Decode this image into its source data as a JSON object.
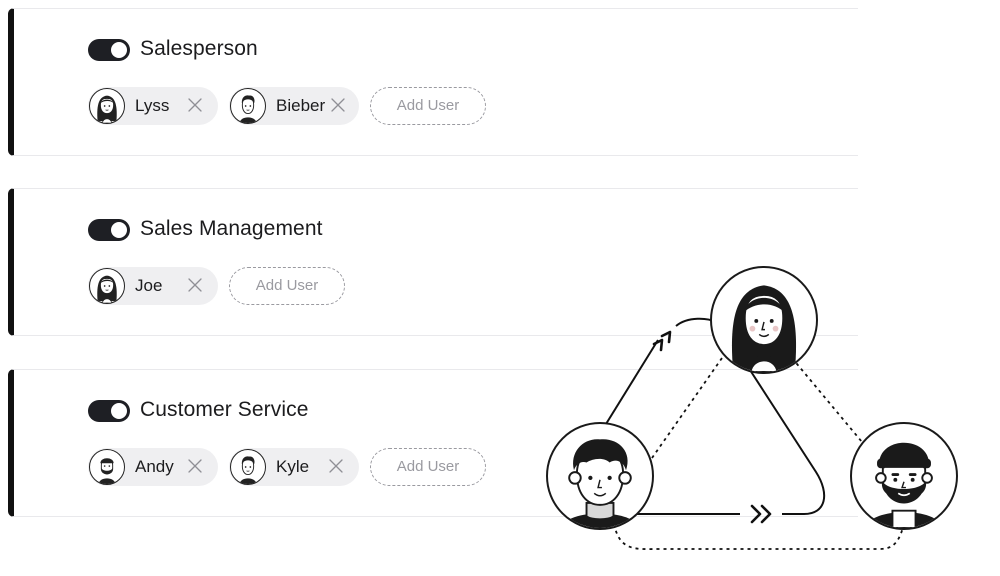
{
  "groups": [
    {
      "title": "Salesperson",
      "enabled": true,
      "users": [
        {
          "name": "Lyss",
          "avatar": "woman-long-hair-avatar"
        },
        {
          "name": "Bieber",
          "avatar": "man-avatar"
        }
      ],
      "add_label": "Add User"
    },
    {
      "title": "Sales Management",
      "enabled": true,
      "users": [
        {
          "name": "Joe",
          "avatar": "woman-long-hair-avatar"
        }
      ],
      "add_label": "Add User"
    },
    {
      "title": "Customer Service",
      "enabled": true,
      "users": [
        {
          "name": "Andy",
          "avatar": "bearded-man-avatar"
        },
        {
          "name": "Kyle",
          "avatar": "man-avatar"
        }
      ],
      "add_label": "Add User"
    }
  ],
  "illustration": {
    "people": [
      "woman-long-hair-icon",
      "man-curly-hair-icon",
      "bearded-man-beanie-icon"
    ],
    "arrows": [
      "double-chevron-up-right-icon",
      "double-chevron-right-icon"
    ]
  },
  "colors": {
    "accent": "#111111",
    "chip_bg": "#efeff1",
    "muted": "#9a9aa0"
  }
}
